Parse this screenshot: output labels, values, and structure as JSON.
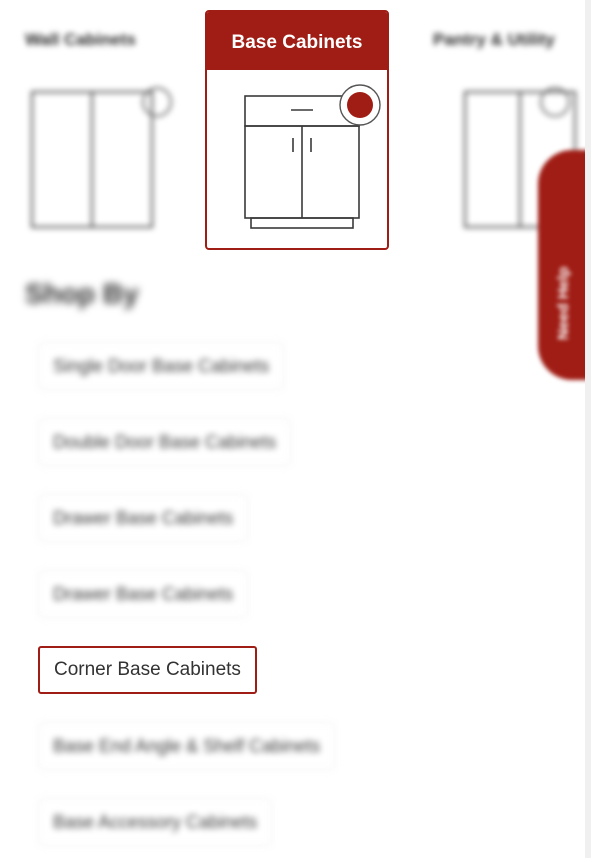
{
  "categories": {
    "left_label": "Wall Cabinets",
    "active_label": "Base Cabinets",
    "right_label": "Pantry & Utility"
  },
  "side_tab": {
    "label": "Need Help"
  },
  "shop_by": {
    "title": "Shop By",
    "items": [
      {
        "label": "Single Door Base Cabinets"
      },
      {
        "label": "Double Door Base Cabinets"
      },
      {
        "label": "Drawer Base Cabinets"
      },
      {
        "label": "Drawer Base Cabinets"
      },
      {
        "label": "Corner Base Cabinets"
      },
      {
        "label": "Base End Angle & Shelf Cabinets"
      },
      {
        "label": "Base Accessory Cabinets"
      }
    ],
    "selected_index": 4
  },
  "colors": {
    "accent": "#a01d15",
    "text": "#333333",
    "background": "#ffffff"
  }
}
